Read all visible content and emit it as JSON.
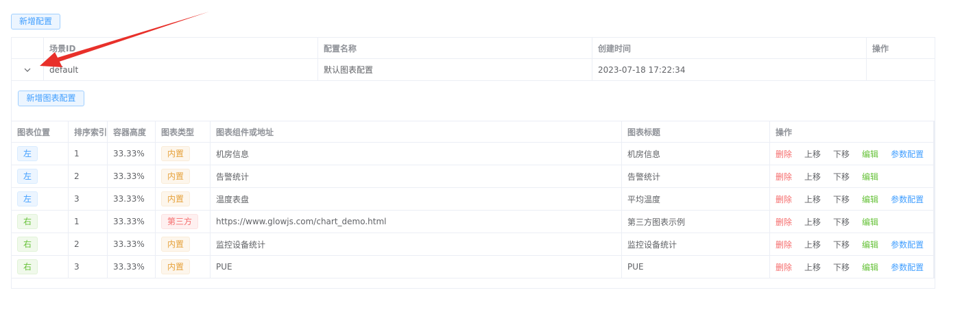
{
  "toolbar": {
    "add_config_label": "新增配置"
  },
  "outer_table": {
    "headers": [
      "",
      "场景ID",
      "配置名称",
      "创建时间",
      "操作"
    ],
    "rows": [
      {
        "scene_id": "default",
        "config_name": "默认图表配置",
        "created_at": "2023-07-18 17:22:34",
        "actions": ""
      }
    ]
  },
  "expand": {
    "add_chart_label": "新增图表配置",
    "headers": [
      "图表位置",
      "排序索引",
      "容器高度",
      "图表类型",
      "图表组件或地址",
      "图表标题",
      "操作"
    ],
    "rows": [
      {
        "position": "左",
        "position_color": "blue",
        "index": "1",
        "height": "33.33%",
        "type": "内置",
        "type_color": "orange",
        "component": "机房信息",
        "title": "机房信息",
        "has_param": true
      },
      {
        "position": "左",
        "position_color": "blue",
        "index": "2",
        "height": "33.33%",
        "type": "内置",
        "type_color": "orange",
        "component": "告警统计",
        "title": "告警统计",
        "has_param": false
      },
      {
        "position": "左",
        "position_color": "blue",
        "index": "3",
        "height": "33.33%",
        "type": "内置",
        "type_color": "orange",
        "component": "温度表盘",
        "title": "平均温度",
        "has_param": true
      },
      {
        "position": "右",
        "position_color": "green",
        "index": "1",
        "height": "33.33%",
        "type": "第三方",
        "type_color": "red",
        "component": "https://www.glowjs.com/chart_demo.html",
        "title": "第三方图表示例",
        "has_param": false
      },
      {
        "position": "右",
        "position_color": "green",
        "index": "2",
        "height": "33.33%",
        "type": "内置",
        "type_color": "orange",
        "component": "监控设备统计",
        "title": "监控设备统计",
        "has_param": true
      },
      {
        "position": "右",
        "position_color": "green",
        "index": "3",
        "height": "33.33%",
        "type": "内置",
        "type_color": "orange",
        "component": "PUE",
        "title": "PUE",
        "has_param": true
      }
    ],
    "actions": {
      "delete": "删除",
      "up": "上移",
      "down": "下移",
      "edit": "编辑",
      "param": "参数配置"
    }
  },
  "colors": {
    "primary": "#409eff",
    "success": "#67c23a",
    "warning": "#e6a23c",
    "danger": "#f56c6c",
    "annotation_arrow": "#e8302a"
  },
  "icons": {
    "expand": "chevron-down-icon"
  }
}
